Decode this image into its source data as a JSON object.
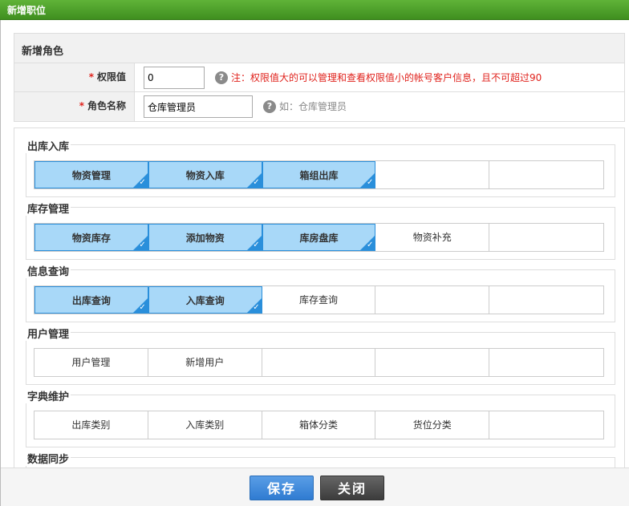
{
  "window": {
    "title": "新增职位"
  },
  "form": {
    "section_title": "新增角色",
    "required_mark": "*",
    "level_label": "权限值",
    "level_value": "0",
    "level_hint": "注：权限值大的可以管理和查看权限值小的帐号客户信息，且不可超过90",
    "name_label": "角色名称",
    "name_value": "仓库管理员",
    "name_hint": "如：仓库管理员",
    "hint_icon": "?"
  },
  "groups": [
    {
      "title": "出库入库",
      "items": [
        {
          "label": "物资管理",
          "selected": true
        },
        {
          "label": "物资入库",
          "selected": true
        },
        {
          "label": "箱组出库",
          "selected": true
        },
        {
          "label": "",
          "selected": false
        },
        {
          "label": "",
          "selected": false
        }
      ]
    },
    {
      "title": "库存管理",
      "items": [
        {
          "label": "物资库存",
          "selected": true
        },
        {
          "label": "添加物资",
          "selected": true
        },
        {
          "label": "库房盘库",
          "selected": true
        },
        {
          "label": "物资补充",
          "selected": false
        },
        {
          "label": "",
          "selected": false
        }
      ]
    },
    {
      "title": "信息查询",
      "items": [
        {
          "label": "出库查询",
          "selected": true
        },
        {
          "label": "入库查询",
          "selected": true
        },
        {
          "label": "库存查询",
          "selected": false
        },
        {
          "label": "",
          "selected": false
        },
        {
          "label": "",
          "selected": false
        }
      ]
    },
    {
      "title": "用户管理",
      "items": [
        {
          "label": "用户管理",
          "selected": false
        },
        {
          "label": "新增用户",
          "selected": false
        },
        {
          "label": "",
          "selected": false
        },
        {
          "label": "",
          "selected": false
        },
        {
          "label": "",
          "selected": false
        }
      ]
    },
    {
      "title": "字典维护",
      "items": [
        {
          "label": "出库类别",
          "selected": false
        },
        {
          "label": "入库类别",
          "selected": false
        },
        {
          "label": "箱体分类",
          "selected": false
        },
        {
          "label": "货位分类",
          "selected": false
        },
        {
          "label": "",
          "selected": false
        }
      ]
    },
    {
      "title": "数据同步",
      "items": []
    }
  ],
  "footer": {
    "save_label": "保存",
    "close_label": "关闭"
  },
  "colors": {
    "title_bar": "#4a9e28",
    "selected_bg": "#a8d8f8",
    "selected_border": "#2a8fdb",
    "hint_red": "#e0221c"
  }
}
